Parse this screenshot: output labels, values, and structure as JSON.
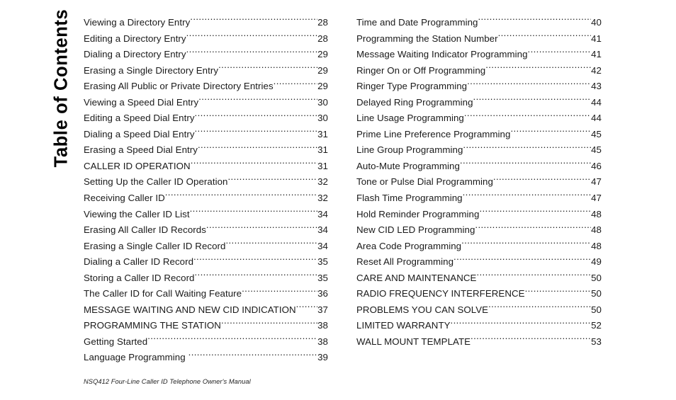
{
  "page": {
    "side_title": "Table of Contents",
    "footer": "NSQ412 Four-Line Caller ID Telephone Owner's Manual"
  },
  "toc": {
    "left_column": [
      {
        "title": "Viewing a Directory Entry",
        "page": "28"
      },
      {
        "title": "Editing a Directory Entry",
        "page": "28"
      },
      {
        "title": "Dialing a Directory Entry",
        "page": "29"
      },
      {
        "title": "Erasing a Single Directory Entry",
        "page": "29"
      },
      {
        "title": "Erasing All Public or Private Directory Entries",
        "page": "29"
      },
      {
        "title": "Viewing a Speed Dial Entry",
        "page": "30"
      },
      {
        "title": "Editing a Speed Dial Entry",
        "page": "30"
      },
      {
        "title": "Dialing a Speed Dial Entry",
        "page": "31"
      },
      {
        "title": "Erasing a Speed Dial Entry",
        "page": "31"
      },
      {
        "title": "CALLER ID OPERATION",
        "page": "31"
      },
      {
        "title": "Setting Up the Caller ID Operation",
        "page": "32"
      },
      {
        "title": "Receiving Caller ID",
        "page": "32"
      },
      {
        "title": "Viewing the Caller ID List",
        "page": "34"
      },
      {
        "title": "Erasing All Caller ID Records",
        "page": "34"
      },
      {
        "title": "Erasing a Single Caller ID Record",
        "page": "34"
      },
      {
        "title": "Dialing a Caller ID Record",
        "page": "35"
      },
      {
        "title": "Storing a Caller ID Record",
        "page": "35"
      },
      {
        "title": "The Caller ID for Call Waiting Feature",
        "page": "36"
      },
      {
        "title": "MESSAGE WAITING AND NEW CID INDICATION",
        "page": "37"
      },
      {
        "title": "PROGRAMMING THE STATION",
        "page": "38"
      },
      {
        "title": "Getting Started",
        "page": "38"
      },
      {
        "title": "Language Programming",
        "page": "39"
      }
    ],
    "right_column": [
      {
        "title": "Time and Date Programming",
        "page": "40"
      },
      {
        "title": "Programming the Station Number",
        "page": "41"
      },
      {
        "title": "Message Waiting Indicator Programming",
        "page": "41"
      },
      {
        "title": "Ringer On or Off Programming",
        "page": "42"
      },
      {
        "title": "Ringer Type Programming",
        "page": "43"
      },
      {
        "title": "Delayed Ring Programming",
        "page": "44"
      },
      {
        "title": "Line Usage Programming",
        "page": "44"
      },
      {
        "title": "Prime Line Preference Programming",
        "page": "45"
      },
      {
        "title": "Line Group Programming",
        "page": "45"
      },
      {
        "title": "Auto-Mute Programming",
        "page": "46"
      },
      {
        "title": "Tone or Pulse Dial Programming",
        "page": "47"
      },
      {
        "title": "Flash Time Programming",
        "page": "47"
      },
      {
        "title": "Hold Reminder Programming",
        "page": "48"
      },
      {
        "title": "New CID LED Programming",
        "page": "48"
      },
      {
        "title": "Area Code Programming",
        "page": "48"
      },
      {
        "title": "Reset All Programming",
        "page": "49"
      },
      {
        "title": "CARE AND MAINTENANCE",
        "page": "50"
      },
      {
        "title": "RADIO FREQUENCY INTERFERENCE",
        "page": "50"
      },
      {
        "title": "PROBLEMS YOU CAN SOLVE",
        "page": "50"
      },
      {
        "title": "LIMITED WARRANTY",
        "page": "52"
      },
      {
        "title": "WALL MOUNT TEMPLATE",
        "page": "53"
      }
    ]
  }
}
